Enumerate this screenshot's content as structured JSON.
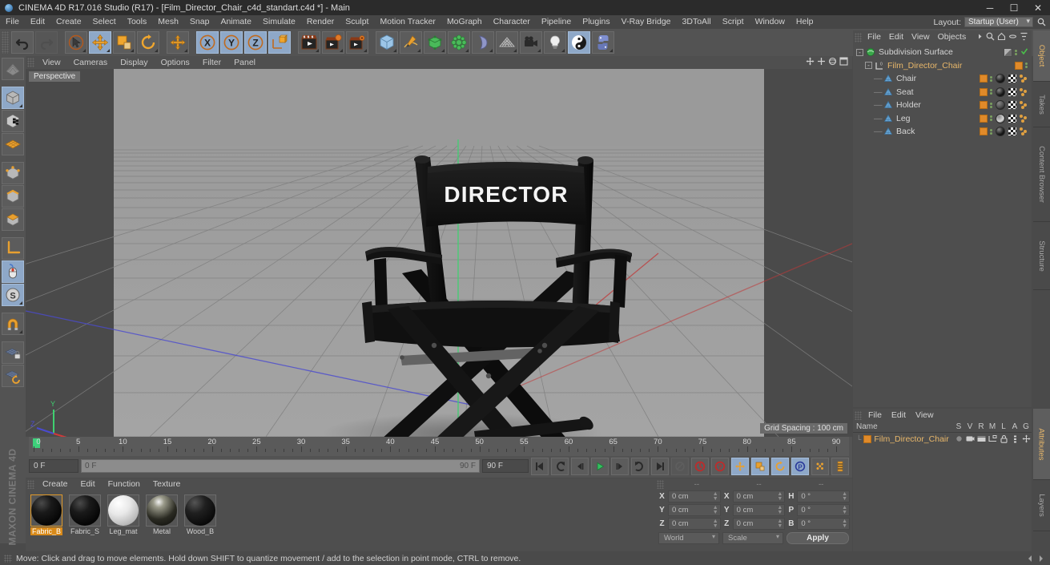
{
  "titlebar": {
    "title": "CINEMA 4D R17.016 Studio (R17) - [Film_Director_Chair_c4d_standart.c4d *] - Main",
    "minimize": "─",
    "maximize": "☐",
    "close": "✕"
  },
  "menubar": {
    "items": [
      "File",
      "Edit",
      "Create",
      "Select",
      "Tools",
      "Mesh",
      "Snap",
      "Animate",
      "Simulate",
      "Render",
      "Sculpt",
      "Motion Tracker",
      "MoGraph",
      "Character",
      "Pipeline",
      "Plugins",
      "V-Ray Bridge",
      "3DToAll",
      "Script",
      "Window",
      "Help"
    ],
    "layout_label": "Layout:",
    "layout_value": "Startup (User)",
    "search_icon": "search-icon"
  },
  "toolbar": {
    "groups": [
      {
        "name": "undo-redo",
        "buttons": [
          {
            "name": "undo-button",
            "icon": "undo-arrow-icon",
            "state": "normal"
          },
          {
            "name": "redo-button",
            "icon": "redo-arrow-icon",
            "state": "disabled"
          }
        ]
      },
      {
        "name": "transform-tools",
        "buttons": [
          {
            "name": "select-tool-button",
            "icon": "cursor-select-icon",
            "state": "normal"
          },
          {
            "name": "move-tool-button",
            "icon": "move-arrows-icon",
            "state": "active"
          },
          {
            "name": "scale-tool-button",
            "icon": "scale-square-icon",
            "state": "normal"
          },
          {
            "name": "rotate-tool-button",
            "icon": "rotate-circle-icon",
            "state": "normal"
          }
        ]
      },
      {
        "name": "axis-extra",
        "buttons": [
          {
            "name": "move-axis-button",
            "icon": "plus-move-icon",
            "state": "normal"
          }
        ]
      },
      {
        "name": "axis-locks",
        "buttons": [
          {
            "name": "lock-x-button",
            "icon": "axis-x-icon",
            "label": "X",
            "state": "active"
          },
          {
            "name": "lock-y-button",
            "icon": "axis-y-icon",
            "label": "Y",
            "state": "active"
          },
          {
            "name": "lock-z-button",
            "icon": "axis-z-icon",
            "label": "Z",
            "state": "active"
          },
          {
            "name": "world-object-axis-button",
            "icon": "world-coordinate-icon",
            "state": "active"
          }
        ]
      },
      {
        "name": "render-tools",
        "buttons": [
          {
            "name": "render-view-button",
            "icon": "clapper-render-icon",
            "state": "normal"
          },
          {
            "name": "render-region-button",
            "icon": "clapper-region-icon",
            "state": "normal"
          },
          {
            "name": "render-settings-button",
            "icon": "clapper-settings-icon",
            "state": "normal"
          }
        ]
      },
      {
        "name": "create-objects",
        "buttons": [
          {
            "name": "add-cube-button",
            "icon": "cube-icon",
            "state": "normal"
          },
          {
            "name": "add-spline-button",
            "icon": "pen-spline-icon",
            "state": "normal"
          },
          {
            "name": "add-generator-button",
            "icon": "generator-green-icon",
            "state": "normal"
          },
          {
            "name": "add-array-button",
            "icon": "array-green-icon",
            "state": "normal"
          },
          {
            "name": "add-deformer-button",
            "icon": "bend-deformer-icon",
            "state": "normal"
          },
          {
            "name": "add-environment-button",
            "icon": "floor-grid-icon",
            "state": "normal"
          },
          {
            "name": "add-camera-button",
            "icon": "camera-icon",
            "state": "normal"
          },
          {
            "name": "add-light-button",
            "icon": "light-bulb-icon",
            "state": "normal"
          },
          {
            "name": "add-vray-button",
            "icon": "vray-sphere-icon",
            "state": "active"
          },
          {
            "name": "python-script-button",
            "icon": "python-icon",
            "state": "normal"
          }
        ]
      }
    ]
  },
  "lefttoolbar": {
    "buttons": [
      {
        "name": "make-editable-button",
        "icon": "make-editable-icon",
        "state": "normal"
      },
      {
        "name": "model-mode-button",
        "icon": "model-cube-icon",
        "state": "active"
      },
      {
        "name": "texture-mode-button",
        "icon": "texture-checker-cube-icon",
        "state": "normal"
      },
      {
        "name": "polygon-mode-button",
        "icon": "polygon-grid-icon",
        "state": "normal"
      },
      {
        "name": "point-mode-button",
        "icon": "point-cube-icon",
        "state": "normal"
      },
      {
        "name": "edge-mode-button",
        "icon": "edge-cube-icon",
        "state": "normal"
      },
      {
        "name": "face-mode-button",
        "icon": "face-cube-icon",
        "state": "normal"
      },
      {
        "name": "axis-mode-button",
        "icon": "axis-corner-icon",
        "state": "normal"
      },
      {
        "name": "viewport-mode-button",
        "icon": "mouse-icon",
        "state": "active"
      },
      {
        "name": "snap-s-button",
        "icon": "snap-s-icon",
        "state": "active"
      },
      {
        "name": "magnet-button",
        "icon": "magnet-icon",
        "state": "normal"
      },
      {
        "name": "workplane-lock-button",
        "icon": "workplane-lock-icon",
        "state": "normal"
      },
      {
        "name": "workplane-rotate-button",
        "icon": "workplane-rotate-icon",
        "state": "normal"
      }
    ],
    "brand_line1": "MAXON",
    "brand_line2": "CINEMA 4D"
  },
  "viewport": {
    "menu": [
      "View",
      "Cameras",
      "Display",
      "Options",
      "Filter",
      "Panel"
    ],
    "camera_label": "Perspective",
    "grid_spacing": "Grid Spacing : 100 cm",
    "nav_icons": [
      "pan-icon",
      "zoom-icon",
      "orbit-icon",
      "maximize-view-icon"
    ],
    "model": {
      "name": "Film_Director_Chair",
      "back_text": "DIRECTOR",
      "material_color": "#141414",
      "floor_color": "#9a9a9a"
    },
    "axis_gizmo": {
      "x_label": "X",
      "y_label": "Y",
      "z_label": "Z"
    }
  },
  "timeline": {
    "tick_labels": [
      "0",
      "5",
      "10",
      "15",
      "20",
      "25",
      "30",
      "35",
      "40",
      "45",
      "50",
      "55",
      "60",
      "65",
      "70",
      "75",
      "80",
      "85",
      "90"
    ],
    "range_start": 0,
    "range_end": 90,
    "current_frame_field": "0 F",
    "slider_left": "0 F",
    "slider_right": "90 F",
    "end_frame_field": "90 F",
    "preview_min": "0 F",
    "controls": [
      {
        "name": "go-to-start-button",
        "icon": "skip-start-icon",
        "state": "normal"
      },
      {
        "name": "previous-keyframe-button",
        "icon": "prev-key-icon",
        "state": "normal"
      },
      {
        "name": "previous-frame-button",
        "icon": "step-back-icon",
        "state": "normal"
      },
      {
        "name": "play-button",
        "icon": "play-icon",
        "state": "active"
      },
      {
        "name": "next-frame-button",
        "icon": "step-forward-icon",
        "state": "normal"
      },
      {
        "name": "next-keyframe-button",
        "icon": "next-key-icon",
        "state": "normal"
      },
      {
        "name": "go-to-end-button",
        "icon": "skip-end-icon",
        "state": "normal"
      },
      {
        "name": "record-active-objects-button",
        "icon": "record-dot-icon",
        "state": "disabled"
      },
      {
        "name": "autokeying-button",
        "icon": "autokey-circle-icon",
        "state": "normal"
      },
      {
        "name": "keyframe-selection-button",
        "icon": "question-key-icon",
        "state": "normal"
      },
      {
        "name": "position-key-button",
        "icon": "position-key-icon",
        "state": "active"
      },
      {
        "name": "scale-key-button",
        "icon": "scale-key-icon",
        "state": "active"
      },
      {
        "name": "rotation-key-button",
        "icon": "rotation-key-icon",
        "state": "active"
      },
      {
        "name": "parameter-key-button",
        "icon": "param-p-key-icon",
        "state": "active"
      },
      {
        "name": "point-level-anim-button",
        "icon": "pla-dots-icon",
        "state": "normal"
      },
      {
        "name": "timeline-layout-button",
        "icon": "timeline-bars-icon",
        "state": "normal"
      }
    ]
  },
  "material_manager": {
    "menu": [
      "Create",
      "Edit",
      "Function",
      "Texture"
    ],
    "materials": [
      {
        "name": "Fabric_B",
        "selected": true,
        "swatch": "dark-fabric"
      },
      {
        "name": "Fabric_S",
        "selected": false,
        "swatch": "dark-fabric"
      },
      {
        "name": "Leg_mat",
        "selected": false,
        "swatch": "white-glossy"
      },
      {
        "name": "Metal",
        "selected": false,
        "swatch": "metal"
      },
      {
        "name": "Wood_B",
        "selected": false,
        "swatch": "dark-wood"
      }
    ]
  },
  "coordinates": {
    "header": [
      "--",
      "--",
      "--"
    ],
    "rows": [
      {
        "pos_label": "X",
        "pos_value": "0 cm",
        "size_label": "X",
        "size_value": "0 cm",
        "rot_label": "H",
        "rot_value": "0 °"
      },
      {
        "pos_label": "Y",
        "pos_value": "0 cm",
        "size_label": "Y",
        "size_value": "0 cm",
        "rot_label": "P",
        "rot_value": "0 °"
      },
      {
        "pos_label": "Z",
        "pos_value": "0 cm",
        "size_label": "Z",
        "size_value": "0 cm",
        "rot_label": "B",
        "rot_value": "0 °"
      }
    ],
    "coord_system": "World",
    "size_mode": "Scale",
    "apply_label": "Apply"
  },
  "object_manager": {
    "menu": [
      "File",
      "Edit",
      "View",
      "Objects"
    ],
    "header_icons": [
      "more-arrow-icon",
      "search-icon",
      "home-icon",
      "dash-icon",
      "filter-icon"
    ],
    "rows": [
      {
        "name": "Subdivision Surface",
        "indent": 0,
        "icon": "subdivision-surface-icon",
        "expander": "-",
        "tag_checker": false,
        "tag_orange": false,
        "show_dots": true,
        "has_green_check": true,
        "has_gray_tag": true
      },
      {
        "name": "Film_Director_Chair",
        "indent": 1,
        "icon": "null-object-icon",
        "expander": "-",
        "tag_checker": false,
        "tag_orange": true,
        "show_dots": true,
        "has_green_check": false,
        "has_gray_tag": false
      },
      {
        "name": "Chair",
        "indent": 2,
        "icon": "polygon-object-icon",
        "expander": "",
        "tag_checker": true,
        "tag_orange": true,
        "show_dots": true,
        "mat_color": "#1a1a1a"
      },
      {
        "name": "Seat",
        "indent": 2,
        "icon": "polygon-object-icon",
        "expander": "",
        "tag_checker": true,
        "tag_orange": true,
        "show_dots": true,
        "mat_color": "#1a1a1a"
      },
      {
        "name": "Holder",
        "indent": 2,
        "icon": "polygon-object-icon",
        "expander": "",
        "tag_checker": true,
        "tag_orange": true,
        "show_dots": true,
        "mat_color": "#4a4a4a"
      },
      {
        "name": "Leg",
        "indent": 2,
        "icon": "polygon-object-icon",
        "expander": "",
        "tag_checker": true,
        "tag_orange": true,
        "show_dots": true,
        "mat_color": "#d8d8d8"
      },
      {
        "name": "Back",
        "indent": 2,
        "icon": "polygon-object-icon",
        "expander": "",
        "tag_checker": true,
        "tag_orange": true,
        "show_dots": true,
        "mat_color": "#1a1a1a"
      }
    ]
  },
  "layer_manager": {
    "menu": [
      "File",
      "Edit",
      "View"
    ],
    "columns": [
      "Name",
      "S",
      "V",
      "R",
      "M",
      "L",
      "A",
      "G"
    ],
    "rows": [
      {
        "name": "Film_Director_Chair",
        "swatch": "#e08a2a"
      }
    ]
  },
  "right_tabs_top": [
    "Object",
    "Takes",
    "Content Browser",
    "Structure"
  ],
  "right_tabs_bottom": [
    "Attributes",
    "Layers"
  ],
  "statusbar": {
    "text": "Move: Click and drag to move elements. Hold down SHIFT to quantize movement / add to the selection in point mode, CTRL to remove."
  }
}
